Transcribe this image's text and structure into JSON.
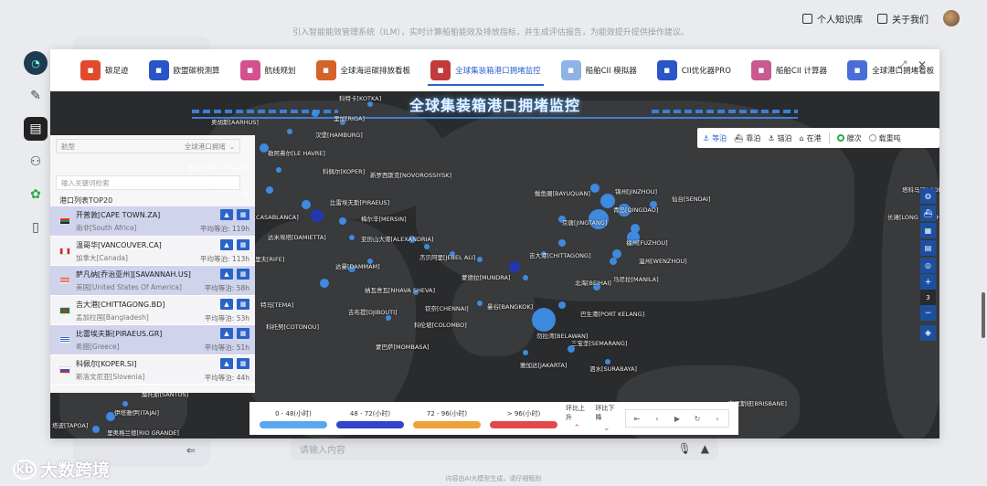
{
  "app": {
    "topbar": {
      "knowledge_base": "个人知识库",
      "about": "关于我们"
    },
    "background_text": "引入智能能效管理系统（ILM），实时计算船舶能效及排放指标，并生成评估报告，为能效提升提供操作建议。",
    "input_placeholder": "请输入内容",
    "footnote": "内容由AI大模型生成，请仔细甄别",
    "brand": "大数跨境"
  },
  "modal": {
    "tabs": [
      {
        "label": "碳足迹",
        "icon": "footprint-icon",
        "color": "#e24a2b"
      },
      {
        "label": "欧盟碳税测算",
        "icon": "ets-icon",
        "color": "#2a55c9"
      },
      {
        "label": "航线规划",
        "icon": "route-icon",
        "color": "#d64f8e"
      },
      {
        "label": "全球海运碳排放看板",
        "icon": "board-icon",
        "color": "#d4632a"
      },
      {
        "label": "全球集装箱港口拥堵监控",
        "icon": "monitor-icon",
        "color": "#c23b3b"
      },
      {
        "label": "船舶CII 模拟器",
        "icon": "ship-icon",
        "color": "#8fb3e6"
      },
      {
        "label": "CII优化器PRO",
        "icon": "optimizer-icon",
        "color": "#2a55c9"
      },
      {
        "label": "船舶CII 计算器",
        "icon": "calculator-icon",
        "color": "#c85a8f"
      },
      {
        "label": "全球港口拥堵看板",
        "icon": "port-board-icon",
        "color": "#4a6ed8"
      }
    ],
    "active_tab": 4
  },
  "map": {
    "title": "全球集装箱港口拥堵监控",
    "modes": [
      {
        "label": "等泊",
        "icon": "anchor-wait-icon",
        "active": true
      },
      {
        "label": "靠泊",
        "icon": "berth-icon",
        "active": false
      },
      {
        "label": "锚泊",
        "icon": "anchor-icon",
        "active": false
      },
      {
        "label": "在港",
        "icon": "in-port-icon",
        "active": false
      }
    ],
    "toggles": [
      {
        "label": "艘次",
        "checked": true
      },
      {
        "label": "载重吨",
        "checked": false
      }
    ],
    "zoom_level": "3",
    "labels": [
      {
        "t": "科特卡[KOTKA]"
      },
      {
        "t": "奥胡斯[AARHUS]"
      },
      {
        "t": "里加[RIGA]"
      },
      {
        "t": "汉堡[HAMBURG]"
      },
      {
        "t": "勒阿弗尔[LE HAVRE]"
      },
      {
        "t": "鹿特丹[ROTTERDAM]"
      },
      {
        "t": "科佩尔[KOPER]"
      },
      {
        "t": "新罗西斯克[NOVOROSSIYSK]"
      },
      {
        "t": "比雷埃夫斯[PIRAEUS]"
      },
      {
        "t": "卡萨布兰卡[CASABLANCA]"
      },
      {
        "t": "梅尔辛[MERSIN]"
      },
      {
        "t": "达米埃塔[DAMIETTA]"
      },
      {
        "t": "亚历山大港[ALEXANDRIA]"
      },
      {
        "t": "杰贝阿里[JEBEL ALI]"
      },
      {
        "t": "达曼[DAMMAM]"
      },
      {
        "t": "蒙德拉[MUNDRA]"
      },
      {
        "t": "纳瓦舍瓦[NHAVA SHEVA]"
      },
      {
        "t": "吉布提[DJIBOUTI]"
      },
      {
        "t": "钦奈[CHENNAI]"
      },
      {
        "t": "曼谷[BANGKOK]"
      },
      {
        "t": "科伦坡[COLOMBO]"
      },
      {
        "t": "特马[TEMA]"
      },
      {
        "t": "科托努[COTONOU]"
      },
      {
        "t": "蒙巴萨[MOMBASA]"
      },
      {
        "t": "鲅鱼圈[BAYUQUAN]"
      },
      {
        "t": "锦州[JINZHOU]"
      },
      {
        "t": "仙台[SENDAI]"
      },
      {
        "t": "青岛[QINGDAO]"
      },
      {
        "t": "京唐[JINGTANG]"
      },
      {
        "t": "福州[FUZHOU]"
      },
      {
        "t": "温州[WENZHOU]"
      },
      {
        "t": "吉大港[CHITTAGONG]"
      },
      {
        "t": "北海[BEIHAI]"
      },
      {
        "t": "马尼拉[MANILA]"
      },
      {
        "t": "巴生港[PORT KELANG]"
      },
      {
        "t": "勿拉湾[BELAWAN]"
      },
      {
        "t": "三宝垄[SEMARANG]"
      },
      {
        "t": "雅加达[JAKARTA]"
      },
      {
        "t": "泗水[SURABAYA]"
      },
      {
        "t": "塔科马[TACOMA]"
      },
      {
        "t": "长滩[LONG BEACH]"
      },
      {
        "t": "布里斯班[BRISBANE]"
      },
      {
        "t": "桑托斯[SANTOS]"
      },
      {
        "t": "伊塔雅伊[ITAJAI]"
      },
      {
        "t": "里奥格兰德[RIO GRANDE]"
      },
      {
        "t": "塔波[TAPOA]"
      },
      {
        "t": "丹吉尔[TANGER]"
      },
      {
        "t": "里夫[RIFE]"
      }
    ]
  },
  "port_panel": {
    "select_placeholder": "航型",
    "select_value": "全球港口拥堵",
    "search_placeholder": "输入关键词检索",
    "list_title": "港口列表TOP20",
    "ports": [
      {
        "name": "开普敦[CAPE TOWN.ZA]",
        "country": "南非[South Africa]",
        "wait": "平均等泊: 119h",
        "flag": "za"
      },
      {
        "name": "温哥华[VANCOUVER.CA]",
        "country": "加拿大[Canada]",
        "wait": "平均等泊: 113h",
        "flag": "ca"
      },
      {
        "name": "萨凡纳[乔治亚州][SAVANNAH.US]",
        "country": "美国[United States Of America]",
        "wait": "平均等泊: 58h",
        "flag": "us"
      },
      {
        "name": "吉大港[CHITTAGONG.BD]",
        "country": "孟加拉国[Bangladesh]",
        "wait": "平均等泊: 53h",
        "flag": "bd"
      },
      {
        "name": "比雷埃夫斯[PIRAEUS.GR]",
        "country": "希腊[Greece]",
        "wait": "平均等泊: 51h",
        "flag": "gr"
      },
      {
        "name": "科佩尔[KOPER.SI]",
        "country": "斯洛文尼亚[Slovenia]",
        "wait": "平均等泊: 44h",
        "flag": "si"
      }
    ]
  },
  "legend": {
    "items": [
      {
        "label": "0 - 48(小时)",
        "color": "#5aa7f0"
      },
      {
        "label": "48 - 72(小时)",
        "color": "#3344cc"
      },
      {
        "label": "72 - 96(小时)",
        "color": "#f0a23a"
      },
      {
        "label": "> 96(小时)",
        "color": "#e24a4a"
      }
    ],
    "trend_up": "环比上升",
    "trend_down": "环比下降"
  }
}
